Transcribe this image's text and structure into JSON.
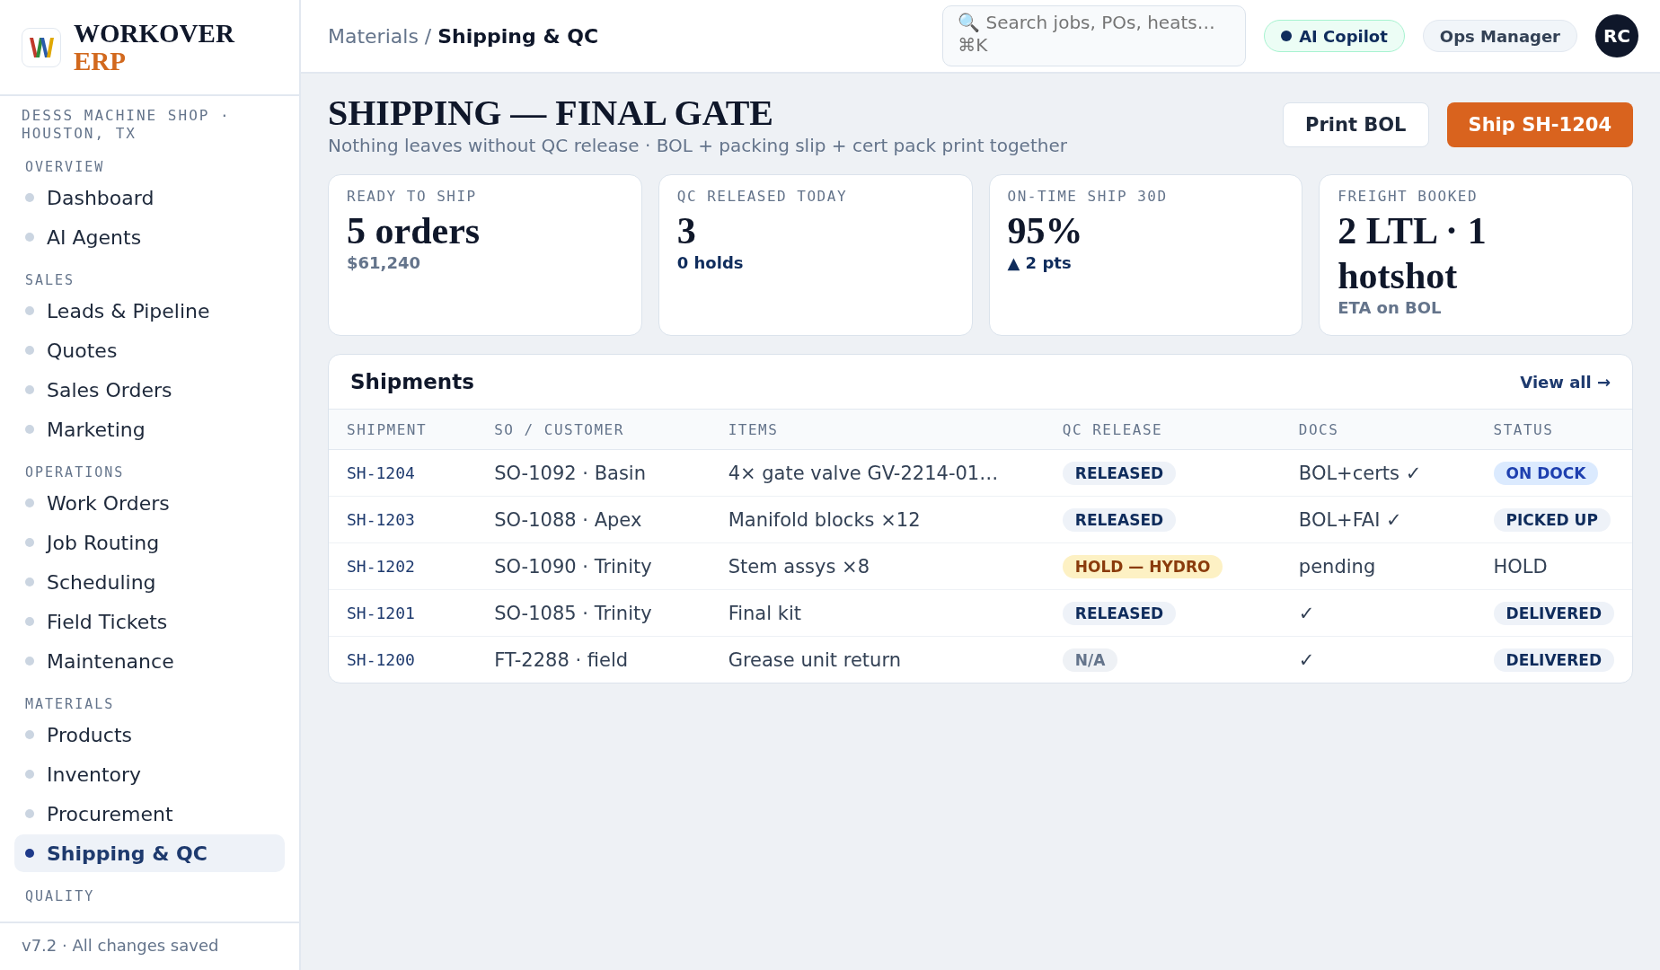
{
  "brand": {
    "name": "WORKOVER",
    "suffix": "ERP"
  },
  "org": "DESSS MACHINE SHOP · HOUSTON, TX",
  "sidebar": {
    "sections": [
      {
        "title": "OVERVIEW",
        "items": [
          {
            "label": "Dashboard",
            "selected": false
          },
          {
            "label": "AI Agents",
            "selected": false
          }
        ]
      },
      {
        "title": "SALES",
        "items": [
          {
            "label": "Leads & Pipeline",
            "selected": false
          },
          {
            "label": "Quotes",
            "selected": false
          },
          {
            "label": "Sales Orders",
            "selected": false
          },
          {
            "label": "Marketing",
            "selected": false
          }
        ]
      },
      {
        "title": "OPERATIONS",
        "items": [
          {
            "label": "Work Orders",
            "selected": false
          },
          {
            "label": "Job Routing",
            "selected": false
          },
          {
            "label": "Scheduling",
            "selected": false
          },
          {
            "label": "Field Tickets",
            "selected": false
          },
          {
            "label": "Maintenance",
            "selected": false
          }
        ]
      },
      {
        "title": "MATERIALS",
        "items": [
          {
            "label": "Products",
            "selected": false
          },
          {
            "label": "Inventory",
            "selected": false
          },
          {
            "label": "Procurement",
            "selected": false
          },
          {
            "label": "Shipping & QC",
            "selected": true
          }
        ]
      },
      {
        "title": "QUALITY"
      }
    ],
    "footer": "v7.2 · All changes saved"
  },
  "topbar": {
    "breadcrumb": {
      "parent": "Materials /",
      "current": "Shipping & QC"
    },
    "search": {
      "placeholder": "🔍 Search jobs, POs, heats… ⌘K"
    },
    "copilot": "AI Copilot",
    "role": "Ops Manager",
    "avatar": "RC"
  },
  "page": {
    "title": "SHIPPING — FINAL GATE",
    "subtitle": "Nothing leaves without QC release · BOL + packing slip + cert pack print together",
    "buttons": [
      {
        "label": "Print BOL",
        "kind": "secondary"
      },
      {
        "label": "Ship SH-1204",
        "kind": "primary"
      }
    ]
  },
  "kpis": [
    {
      "label": "READY TO SHIP",
      "value": "5 orders",
      "note": "$61,240",
      "kind": "muted"
    },
    {
      "label": "QC RELEASED TODAY",
      "value": "3",
      "note": "0 holds",
      "kind": "accent"
    },
    {
      "label": "ON-TIME SHIP 30D",
      "value": "95%",
      "note": "▲ 2 pts",
      "kind": "accent"
    },
    {
      "label": "FREIGHT BOOKED",
      "value": "2 LTL · 1 hotshot",
      "note": "ETA on BOL",
      "kind": "muted"
    }
  ],
  "shipments": {
    "title": "Shipments",
    "link": "View all →",
    "columns": [
      "SHIPMENT",
      "SO / CUSTOMER",
      "ITEMS",
      "QC RELEASE",
      "DOCS",
      "STATUS"
    ],
    "rows": [
      {
        "shipment": "SH-1204",
        "customer": "SO-1092 · Basin",
        "items": "4× gate valve GV-2214-01…",
        "qc": {
          "text": "RELEASED",
          "kind": "released"
        },
        "docs": "BOL+certs ✓",
        "status": {
          "text": "ON DOCK",
          "kind": "info"
        }
      },
      {
        "shipment": "SH-1203",
        "customer": "SO-1088 · Apex",
        "items": "Manifold blocks ×12",
        "qc": {
          "text": "RELEASED",
          "kind": "released"
        },
        "docs": "BOL+FAI ✓",
        "status": {
          "text": "PICKED UP",
          "kind": "done"
        }
      },
      {
        "shipment": "SH-1202",
        "customer": "SO-1090 · Trinity",
        "items": "Stem assys ×8",
        "qc": {
          "text": "HOLD — HYDRO",
          "kind": "hold"
        },
        "docs": "pending",
        "status": {
          "text": "HOLD",
          "kind": "plain"
        }
      },
      {
        "shipment": "SH-1201",
        "customer": "SO-1085 · Trinity",
        "items": "Final kit",
        "qc": {
          "text": "RELEASED",
          "kind": "released"
        },
        "docs": "✓",
        "status": {
          "text": "DELIVERED",
          "kind": "done"
        }
      },
      {
        "shipment": "SH-1200",
        "customer": "FT-2288 · field",
        "items": "Grease unit return",
        "qc": {
          "text": "N/A",
          "kind": "na"
        },
        "docs": "✓",
        "status": {
          "text": "DELIVERED",
          "kind": "done"
        }
      }
    ]
  }
}
